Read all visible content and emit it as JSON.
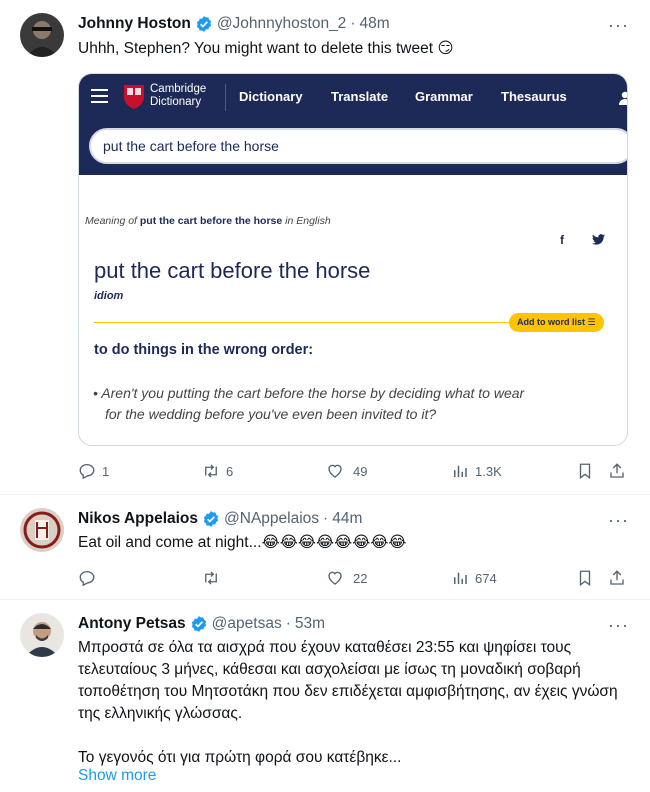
{
  "tweets": [
    {
      "name": "Johnny Hoston",
      "handle": "@Johnnyhoston_2",
      "time": "48m",
      "text": "Uhhh, Stephen? You might want to delete this tweet 😏",
      "stats": {
        "replies": "1",
        "retweets": "6",
        "likes": "49",
        "views": "1.3K"
      }
    },
    {
      "name": "Nikos Appelaios",
      "handle": "@NAppelaios",
      "time": "44m",
      "text": "Eat oil and come at night...😂😂😂😂😂😂😂😂",
      "stats": {
        "replies": "",
        "retweets": "",
        "likes": "22",
        "views": "674"
      }
    },
    {
      "name": "Antony Petsas",
      "handle": "@apetsas",
      "time": "53m",
      "paragraph1": "Μπροστά σε όλα τα αισχρά που έχουν καταθέσει 23:55 και ψηφίσει τους τελευταίους 3 μήνες, κάθεσαι και ασχολείσαι με ίσως τη μοναδική σοβαρή τοποθέτηση του Μητσοτάκη που δεν επιδέχεται αμφισβήτησης, αν έχεις γνώση της ελληνικής γλώσσας.",
      "paragraph2": "Το γεγονός ότι για πρώτη φορά σου κατέβηκε...",
      "show_more": "Show more"
    }
  ],
  "dictionary_card": {
    "brand_line1": "Cambridge",
    "brand_line2": "Dictionary",
    "nav": [
      "Dictionary",
      "Translate",
      "Grammar",
      "Thesaurus"
    ],
    "search_value": "put the cart before the horse",
    "meaning_prefix": "Meaning of ",
    "meaning_term": "put the cart before the horse",
    "meaning_suffix": " in English",
    "share_icons": [
      "facebook-icon",
      "twitter-icon"
    ],
    "headword": "put the cart before the horse",
    "part_of_speech": "idiom",
    "add_to_list": "Add to word list",
    "definition": "to do things in the wrong order:",
    "example_line1": "Aren't you putting the cart before the horse by deciding what to wear",
    "example_line2": "for the wedding before you've even been invited to it?",
    "brand_color": "#1d2a57",
    "accent_color": "#fec400"
  },
  "colors": {
    "verified": "#1d9bf0",
    "muted": "#536471",
    "link": "#1d9bf0"
  }
}
